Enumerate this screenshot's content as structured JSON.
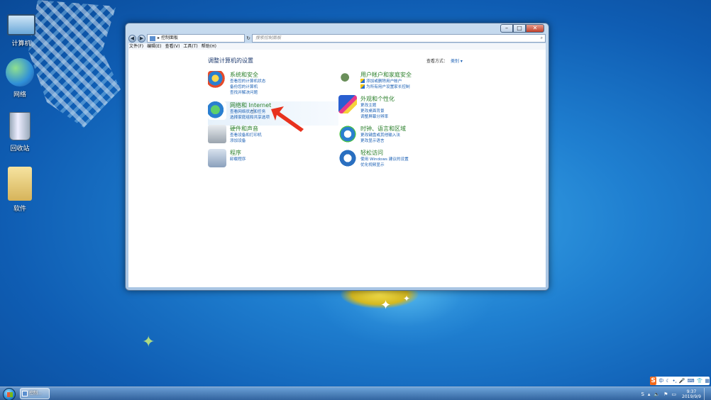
{
  "desktop": {
    "icons": [
      {
        "label": "计算机",
        "icon": "computer-icon"
      },
      {
        "label": "网络",
        "icon": "network-icon"
      },
      {
        "label": "回收站",
        "icon": "recycle-bin-icon"
      },
      {
        "label": "软件",
        "icon": "folder-icon"
      }
    ]
  },
  "window": {
    "address": "控制面板",
    "address_arrow": "▸",
    "search_placeholder": "搜索控制面板",
    "menu": [
      "文件(F)",
      "编辑(E)",
      "查看(V)",
      "工具(T)",
      "帮助(H)"
    ],
    "page_title": "调整计算机的设置",
    "view_by_label": "查看方式：",
    "view_by_value": "类别 ▾",
    "categories_left": [
      {
        "title": "系统和安全",
        "links": [
          "查看您的计算机状态",
          "备份您的计算机",
          "查找并解决问题"
        ],
        "icon": "system-security-icon"
      },
      {
        "title": "网络和 Internet",
        "links": [
          "查看网络状态和任务",
          "选择家庭组和共享选项"
        ],
        "icon": "network-internet-icon",
        "highlighted": true
      },
      {
        "title": "硬件和声音",
        "links": [
          "查看设备和打印机",
          "添加设备"
        ],
        "icon": "hardware-sound-icon"
      },
      {
        "title": "程序",
        "links": [
          "卸载程序"
        ],
        "icon": "programs-icon"
      }
    ],
    "categories_right": [
      {
        "title": "用户帐户和家庭安全",
        "links": [
          "添加或删除用户帐户",
          "为所有用户设置家长控制"
        ],
        "icon": "user-accounts-icon"
      },
      {
        "title": "外观和个性化",
        "links": [
          "更改主题",
          "更改桌面背景",
          "调整屏幕分辨率"
        ],
        "icon": "appearance-icon"
      },
      {
        "title": "时钟、语言和区域",
        "links": [
          "更改键盘或其他输入法",
          "更改显示语言"
        ],
        "icon": "clock-language-icon"
      },
      {
        "title": "轻松访问",
        "links": [
          "使用 Windows 建议的设置",
          "优化视频显示"
        ],
        "icon": "ease-of-access-icon"
      }
    ]
  },
  "taskbar": {
    "task_label": "控制...",
    "time": "9:37",
    "date": "2019/9/9"
  },
  "ime": {
    "logo": "S",
    "mode": "中"
  },
  "colors": {
    "accent": "#1a5fb4",
    "category_title": "#2a7f2a",
    "arrow": "#e8321e"
  }
}
